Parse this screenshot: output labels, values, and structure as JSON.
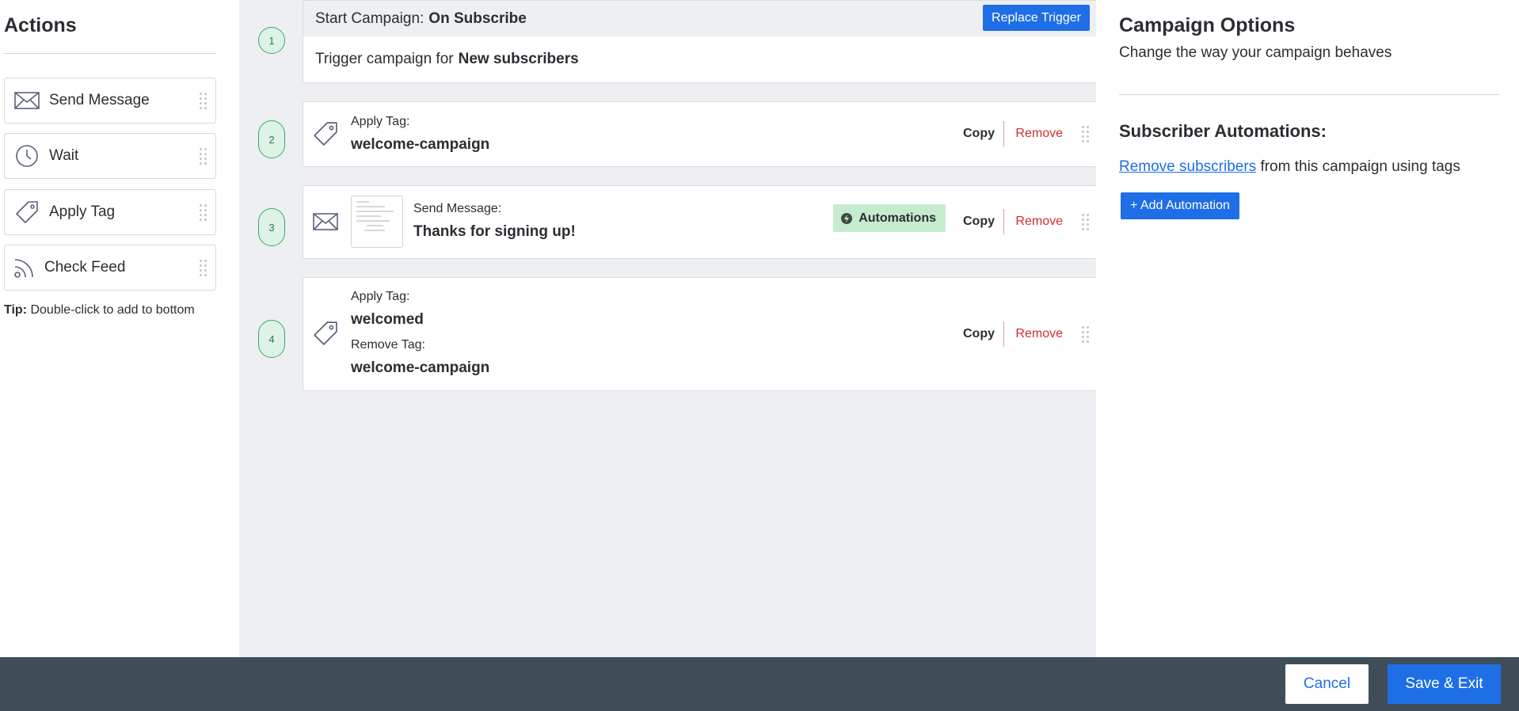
{
  "sidebar": {
    "title": "Actions",
    "items": [
      {
        "label": "Send Message",
        "icon": "envelope-icon"
      },
      {
        "label": "Wait",
        "icon": "clock-icon"
      },
      {
        "label": "Apply Tag",
        "icon": "tag-icon"
      },
      {
        "label": "Check Feed",
        "icon": "rss-feed-icon"
      }
    ],
    "tip_label": "Tip:",
    "tip_text": " Double-click to add to bottom"
  },
  "steps": [
    {
      "number": "1",
      "header_prefix": "Start Campaign:",
      "header_value": "On Subscribe",
      "replace_button": "Replace Trigger",
      "body_prefix": "Trigger campaign for",
      "body_value": "New subscribers"
    },
    {
      "number": "2",
      "label": "Apply Tag:",
      "value": "welcome-campaign",
      "copy": "Copy",
      "remove": "Remove"
    },
    {
      "number": "3",
      "label": "Send Message:",
      "value": "Thanks for signing up!",
      "badge": "Automations",
      "copy": "Copy",
      "remove": "Remove"
    },
    {
      "number": "4",
      "apply_label": "Apply Tag:",
      "apply_value": "welcomed",
      "remove_label": "Remove Tag:",
      "remove_value": "welcome-campaign",
      "copy": "Copy",
      "remove": "Remove"
    }
  ],
  "options": {
    "title": "Campaign Options",
    "subtitle": "Change the way your campaign behaves",
    "section_title": "Subscriber Automations:",
    "link_text": "Remove subscribers",
    "line_rest": " from this campaign using tags",
    "add_button": "+ Add Automation"
  },
  "footer": {
    "cancel": "Cancel",
    "save": "Save & Exit"
  },
  "colors": {
    "accent": "#1e6ee6",
    "remove_red": "#d12d2d",
    "footer_bg": "#3f4d59",
    "step_green": "#3aa66d",
    "badge_green": "#c6eccf"
  }
}
